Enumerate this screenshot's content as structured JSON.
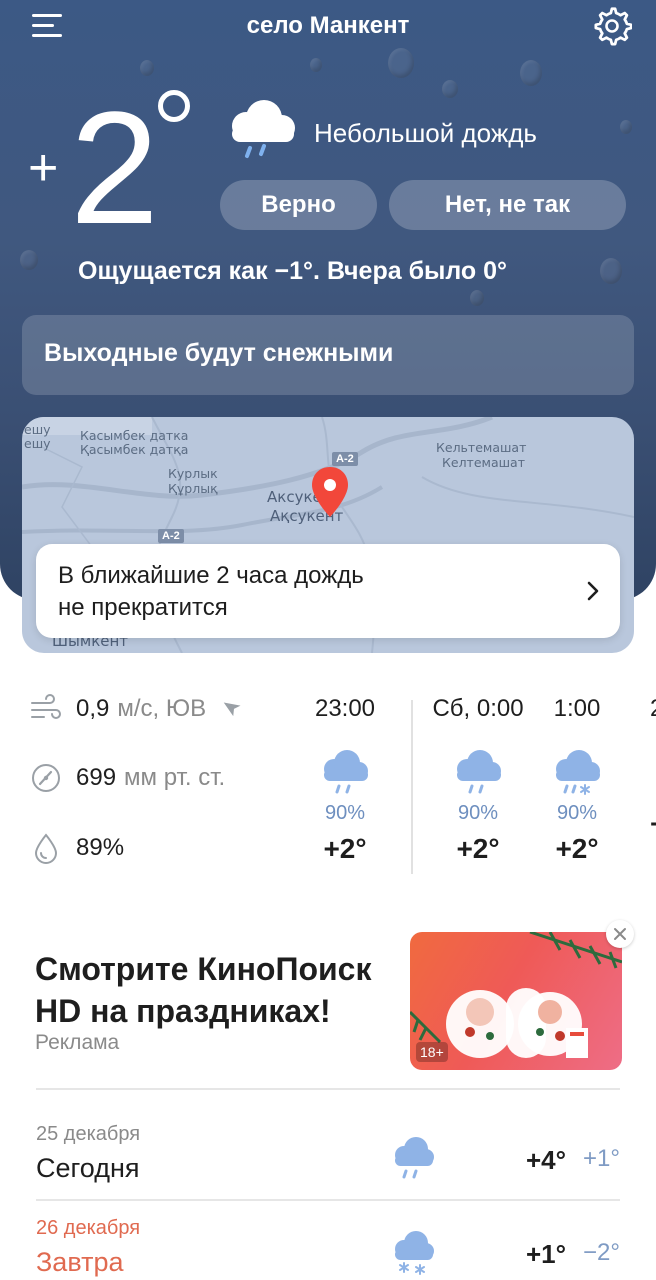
{
  "header": {
    "city": "село Манкент"
  },
  "current": {
    "sign": "+",
    "temp": "2",
    "condition": "Небольшой дождь",
    "feedback_yes": "Верно",
    "feedback_no": "Нет, не так",
    "feels_like": "Ощущается как −1°. Вчера было 0°",
    "icon": "cloud-rain-icon"
  },
  "banner": {
    "text": "Выходные будут снежными"
  },
  "map": {
    "labels": {
      "l1": "Касымбек датка",
      "l2": "Қасымбек датқа",
      "l3": "Курлык",
      "l4": "Құрлық",
      "l5": "Кельтемашат",
      "l6": "Келтемашат",
      "l7": "Аксукент",
      "l8": "Ақсукент",
      "l9": "Шымкент",
      "l10": "ешу",
      "l11": "ешу",
      "road1": "А-2",
      "road2": "А-2"
    },
    "nowcast_line1": "В ближайшие 2 часа дождь",
    "nowcast_line2": "не прекратится"
  },
  "details": {
    "wind_value": "0,9",
    "wind_unit": "м/с, ЮВ",
    "pressure_value": "699",
    "pressure_unit": "мм рт. ст.",
    "humidity": "89%"
  },
  "hourly": [
    {
      "time": "23:00",
      "prob": "90%",
      "temp": "+2°",
      "icon": "cloud-rain-icon"
    },
    {
      "time": "Сб, 0:00",
      "prob": "90%",
      "temp": "+2°",
      "icon": "cloud-rain-icon"
    },
    {
      "time": "1:00",
      "prob": "90%",
      "temp": "+2°",
      "icon": "cloud-sleet-icon"
    },
    {
      "time": "2",
      "prob": "",
      "temp": "+",
      "icon": "cloud-rain-icon"
    }
  ],
  "ad": {
    "title_line1": "Смотрите КиноПоиск",
    "title_line2": "HD на праздниках!",
    "label": "Реклама",
    "age": "18+"
  },
  "forecast": [
    {
      "date": "25 декабря",
      "name": "Сегодня",
      "hi": "+4°",
      "lo": "+1°",
      "icon": "cloud-rain-icon"
    },
    {
      "date": "26 декабря",
      "name": "Завтра",
      "hi": "+1°",
      "lo": "−2°",
      "icon": "cloud-snow-icon"
    }
  ],
  "colors": {
    "hero_bg": "#3c5985",
    "accent_tomorrow": "#e06a50",
    "precip_blue": "#6e8fbf"
  }
}
